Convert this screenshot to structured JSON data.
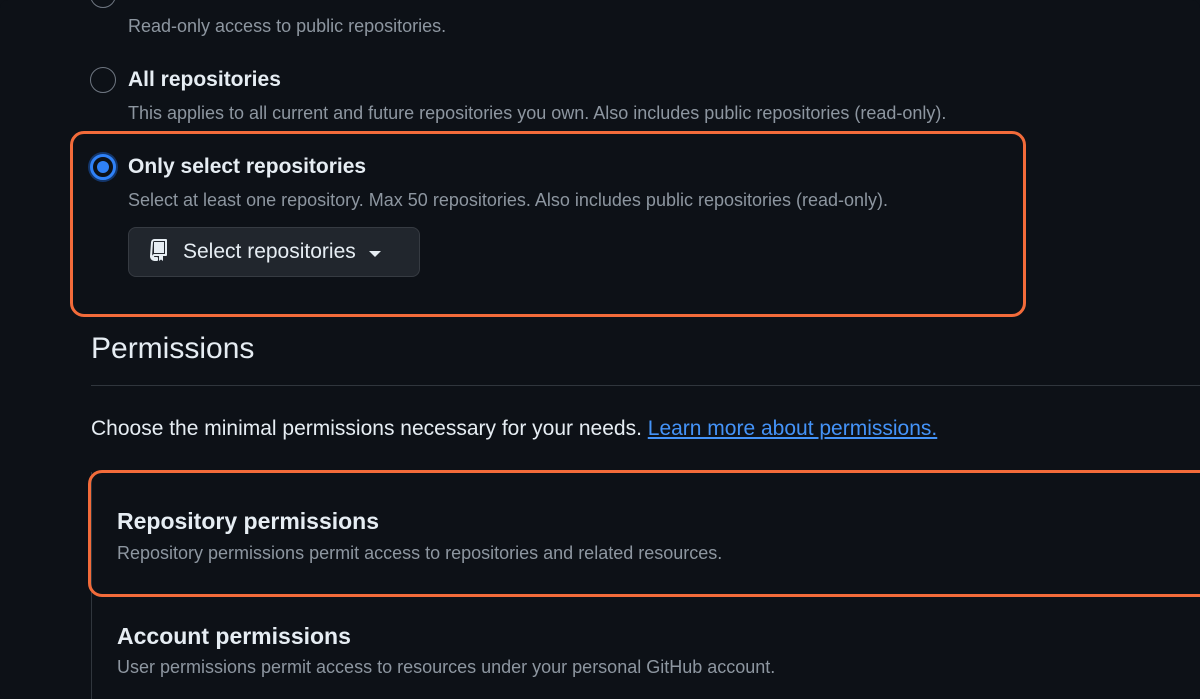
{
  "repository_access": {
    "public_only": {
      "description": "Read-only access to public repositories."
    },
    "all_repositories": {
      "label": "All repositories",
      "description": "This applies to all current and future repositories you own. Also includes public repositories (read-only)."
    },
    "only_select": {
      "label": "Only select repositories",
      "description": "Select at least one repository. Max 50 repositories. Also includes public repositories (read-only).",
      "selected": true,
      "select_button_label": "Select repositories",
      "select_button_icon": "repo-icon"
    }
  },
  "permissions": {
    "title": "Permissions",
    "intro_text": "Choose the minimal permissions necessary for your needs.",
    "learn_more_link": "Learn more about permissions.",
    "sections": [
      {
        "title": "Repository permissions",
        "description": "Repository permissions permit access to repositories and related resources."
      },
      {
        "title": "Account permissions",
        "description": "User permissions permit access to resources under your personal GitHub account."
      }
    ]
  },
  "colors": {
    "background": "#0d1117",
    "highlight": "#f26b3a",
    "accent": "#2f81f7",
    "link": "#4493f8"
  }
}
